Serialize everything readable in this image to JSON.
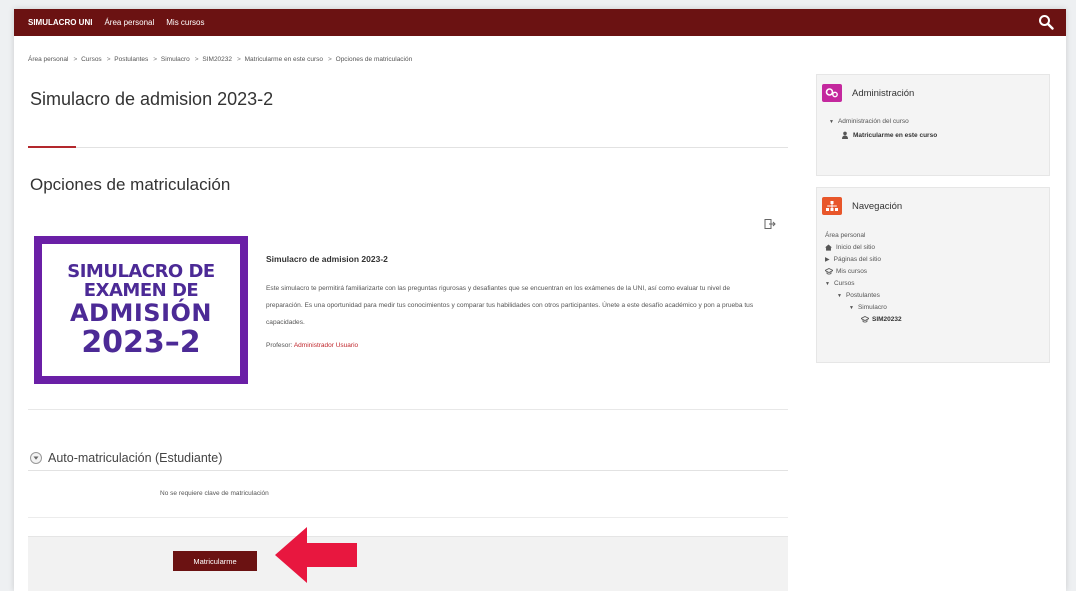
{
  "navbar": {
    "brand": "SIMULACRO UNI",
    "items": [
      "Área personal",
      "Mis cursos"
    ],
    "search_icon": "search-icon",
    "bg": "#6b1212"
  },
  "breadcrumb": [
    "Área personal",
    "Cursos",
    "Postulantes",
    "Simulacro",
    "SIM20232",
    "Matricularme en este curso",
    "Opciones de matriculación"
  ],
  "page": {
    "course_title": "Simulacro de admision 2023-2",
    "section_title": "Opciones de matriculación"
  },
  "course_card": {
    "banner": {
      "line1": "SIMULACRO DE",
      "line2": "EXAMEN DE",
      "line3": "ADMISIÓN",
      "line4": "2023–2",
      "frame_color": "#6a1fa6",
      "text_color": "#4c2a96"
    },
    "title": "Simulacro de admision 2023-2",
    "description": "Este simulacro te permitirá familiarizarte con las preguntas rigurosas y desafiantes que se encuentran en los exámenes de la UNI, así como evaluar tu nivel de preparación. Es una oportunidad para medir tus conocimientos y comparar tus habilidades con otros participantes. Únete a este desafío académico y pon a prueba tus capacidades.",
    "teacher_label": "Profesor:",
    "teacher_name": "Administrador Usuario"
  },
  "self_enrol": {
    "title": "Auto-matriculación (Estudiante)",
    "no_key_text": "No se requiere clave de matriculación",
    "button_label": "Matricularme",
    "arrow_color": "#e8173f"
  },
  "admin_block": {
    "title": "Administración",
    "icon_color": "#c4289e",
    "items": [
      "Administración del curso",
      "Matricularme en este curso"
    ]
  },
  "nav_block": {
    "title": "Navegación",
    "icon_color": "#e8562a",
    "items": [
      "Área personal",
      "Inicio del sitio",
      "Páginas del sitio",
      "Mis cursos",
      "Cursos",
      "Postulantes",
      "Simulacro",
      "SIM20232"
    ]
  }
}
